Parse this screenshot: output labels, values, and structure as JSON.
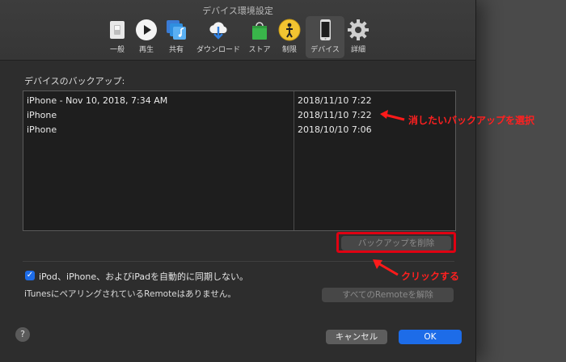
{
  "window": {
    "title": "デバイス環境設定"
  },
  "toolbar": {
    "items": [
      {
        "label": "一般"
      },
      {
        "label": "再生"
      },
      {
        "label": "共有"
      },
      {
        "label": "ダウンロード"
      },
      {
        "label": "ストア"
      },
      {
        "label": "制限"
      },
      {
        "label": "デバイス",
        "selected": true
      },
      {
        "label": "詳細"
      }
    ]
  },
  "backups": {
    "label": "デバイスのバックアップ:",
    "rows": [
      {
        "name": "iPhone - Nov 10, 2018, 7:34 AM",
        "date": "2018/11/10 7:22"
      },
      {
        "name": "iPhone",
        "date": "2018/11/10 7:22"
      },
      {
        "name": "iPhone",
        "date": "2018/10/10 7:06"
      }
    ],
    "delete_button": "バックアップを削除"
  },
  "sync": {
    "checkbox_label": "iPod、iPhone、およびiPadを自動的に同期しない。",
    "checked": true
  },
  "remote": {
    "status": "iTunesにペアリングされているRemoteはありません。",
    "unpair_button": "すべてのRemoteを解除"
  },
  "footer": {
    "help": "?",
    "cancel": "キャンセル",
    "ok": "OK"
  },
  "annotations": {
    "select_backup": "消したいバックアップを選択",
    "click": "クリックする"
  },
  "colors": {
    "accent": "#1d6ce8",
    "annotation": "#e00012",
    "background": "#2d2d2d"
  }
}
